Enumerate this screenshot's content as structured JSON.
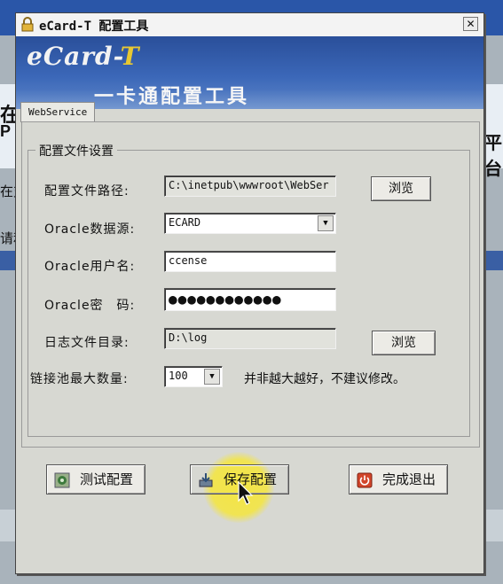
{
  "window": {
    "title": "eCard-T 配置工具",
    "close_label": "✕"
  },
  "banner": {
    "logo_main": "eCard-",
    "logo_accent": "T",
    "subtitle": "一卡通配置工具"
  },
  "tabs": [
    {
      "label": "WebService"
    }
  ],
  "group": {
    "title": "配置文件设置"
  },
  "form": {
    "config_path": {
      "label": "配置文件路径:",
      "value": "C:\\inetpub\\wwwroot\\WebSer",
      "browse_label": "浏览"
    },
    "oracle_source": {
      "label": "Oracle数据源:",
      "value": "ECARD"
    },
    "oracle_user": {
      "label": "Oracle用户名:",
      "value": "ccense"
    },
    "oracle_password": {
      "label": "Oracle密　码:",
      "value": "●●●●●●●●●●●●"
    },
    "log_dir": {
      "label": "日志文件目录:",
      "value": "D:\\log",
      "browse_label": "浏览"
    },
    "pool_max": {
      "label": "链接池最大数量:",
      "value": "100",
      "hint": "并非越大越好，不建议修改。"
    }
  },
  "buttons": {
    "test": "测试配置",
    "save": "保存配置",
    "exit": "完成退出"
  },
  "background_fragments": {
    "left_1": "在",
    "left_2": "P",
    "left_3": "在支",
    "left_4": "请利",
    "right_1": "平台"
  },
  "colors": {
    "banner_blue": "#2a4f9a",
    "logo_accent": "#e7c832",
    "dialog_bg": "#d7d8d2",
    "highlight": "#f5e63c"
  }
}
